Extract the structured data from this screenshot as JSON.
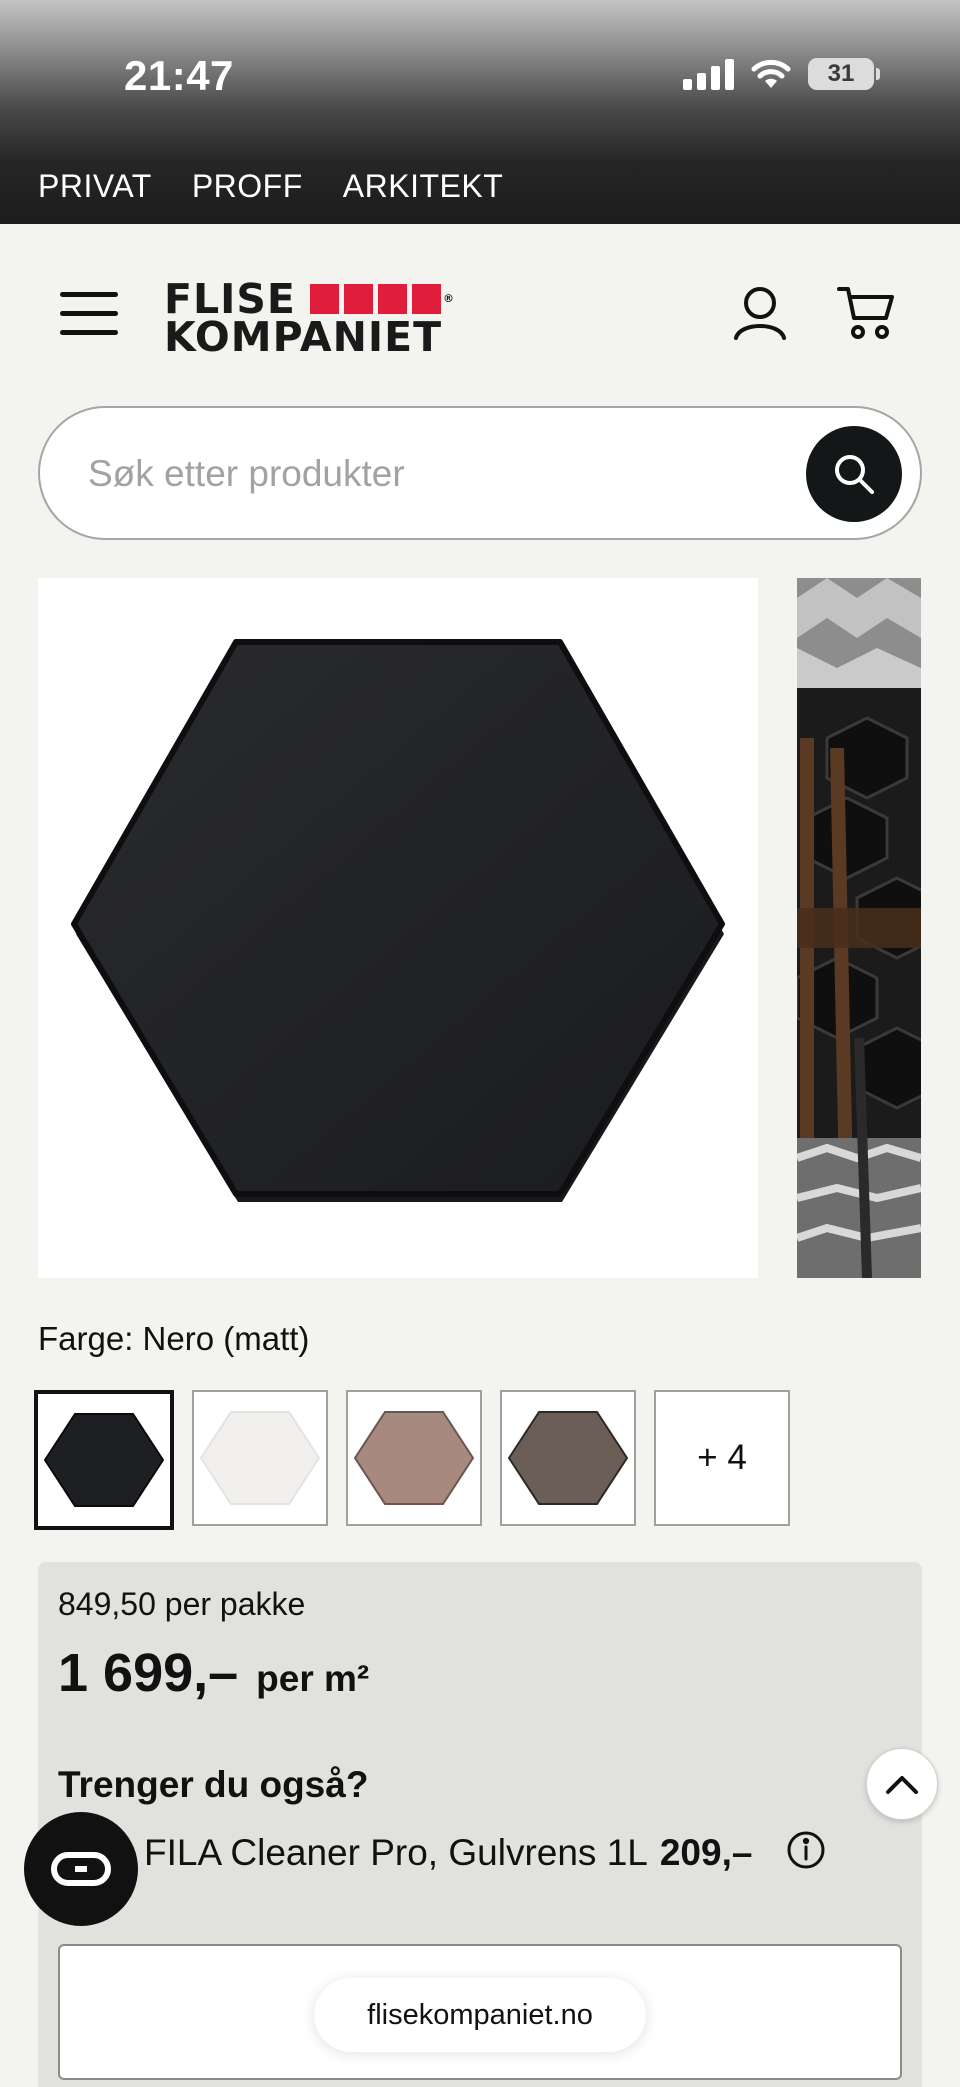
{
  "status_bar": {
    "time": "21:47",
    "battery": "31"
  },
  "segments": [
    "PRIVAT",
    "PROFF",
    "ARKITEKT"
  ],
  "logo": {
    "line1": "FLISE",
    "line2": "KOMPANIET"
  },
  "search": {
    "placeholder": "Søk etter produkter"
  },
  "product": {
    "color_label": "Farge: Nero (matt)",
    "swatches": [
      {
        "color": "#1e1f22",
        "selected": true
      },
      {
        "color": "#f1f0ee",
        "selected": false
      },
      {
        "color": "#a8897d",
        "selected": false
      },
      {
        "color": "#6b5e57",
        "selected": false
      }
    ],
    "more_swatches": "+ 4"
  },
  "pricing": {
    "per_package": "849,50 per pakke",
    "price": "1 699,–",
    "unit": "per m²"
  },
  "addons": {
    "title": "Trenger du også?",
    "item_name": "FILA Cleaner Pro, Gulvrens 1L",
    "item_price": "209,–"
  },
  "browser": {
    "url": "flisekompaniet.no"
  },
  "colors": {
    "brand_red": "#e01e3c",
    "dark": "#131718",
    "panel": "#e1e1dd"
  }
}
